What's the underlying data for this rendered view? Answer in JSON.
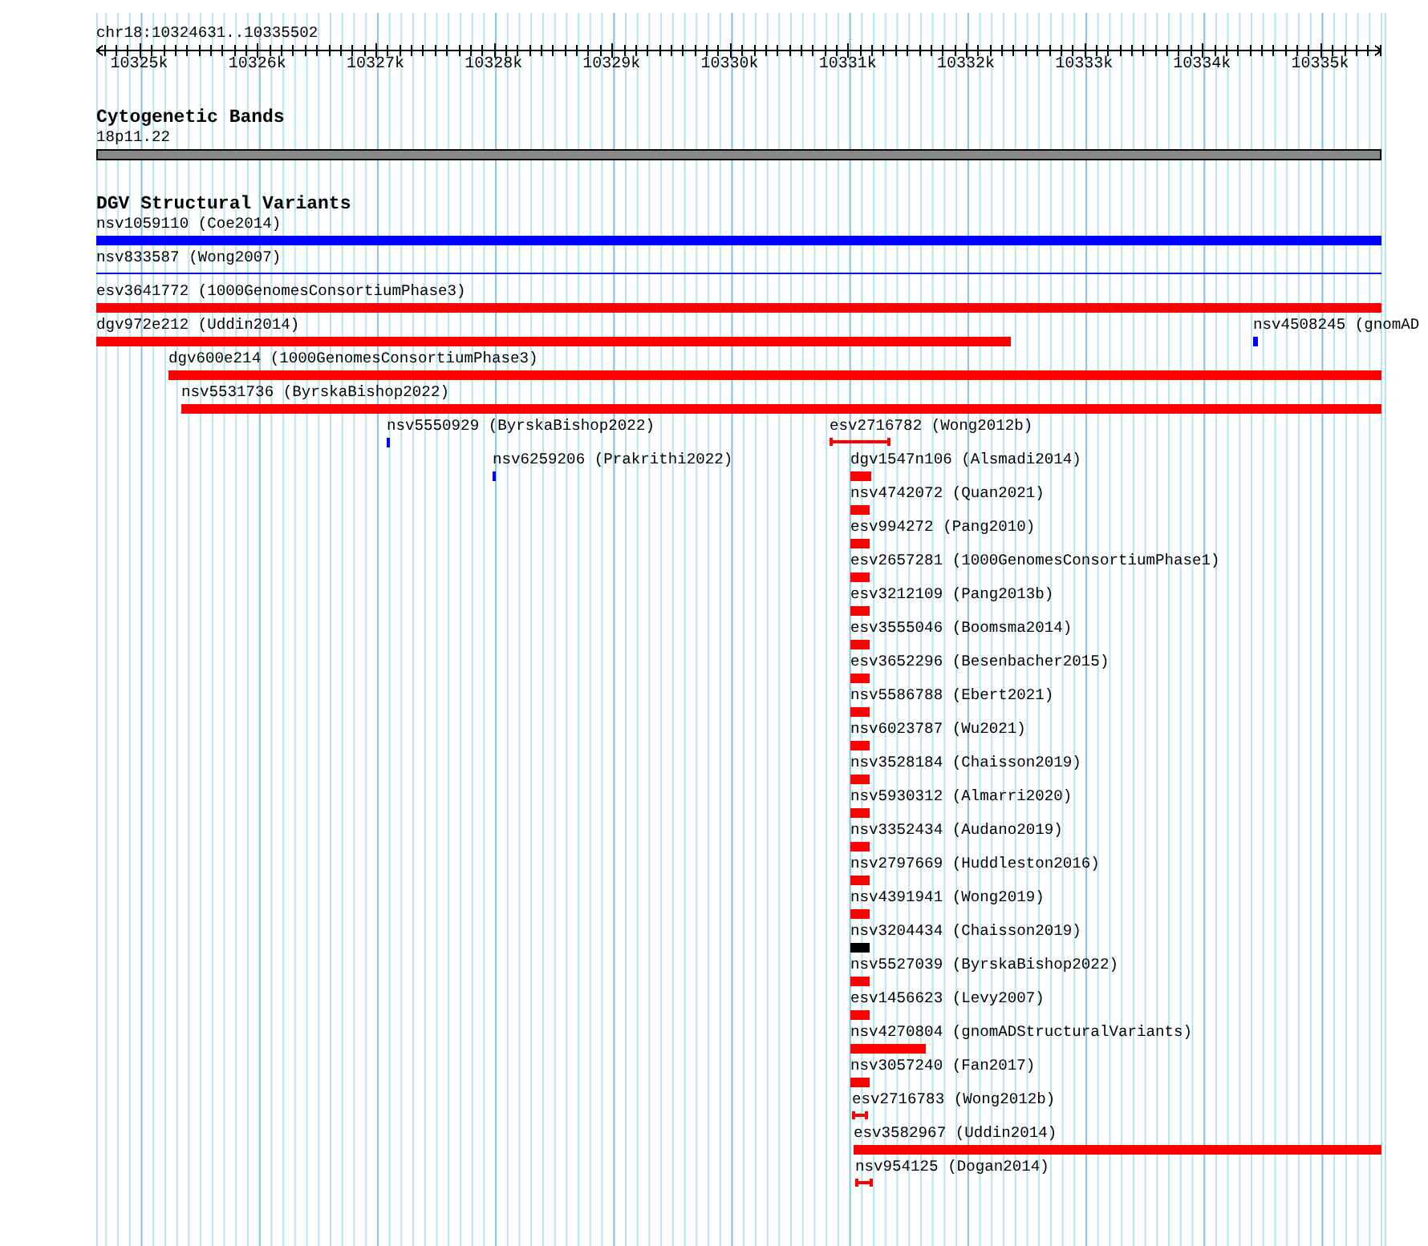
{
  "ruler": {
    "position": "chr18:10324631..10335502",
    "ticks": [
      "10325k",
      "10326k",
      "10327k",
      "10328k",
      "10329k",
      "10330k",
      "10331k",
      "10332k",
      "10333k",
      "10334k",
      "10335k"
    ]
  },
  "cytogenetic_bands": {
    "title": "Cytogenetic Bands",
    "band": "18p11.22"
  },
  "dgv_structural_variants": {
    "title": "DGV Structural Variants",
    "features": [
      {
        "label": "nsv1059110 (Coe2014)",
        "color": "#0000ff",
        "kind": "bar"
      },
      {
        "label": "nsv833587 (Wong2007)",
        "color": "#0000ff",
        "kind": "line"
      },
      {
        "label": "esv3641772 (1000GenomesConsortiumPhase3)",
        "color": "#ff0000",
        "kind": "bar"
      },
      {
        "label": "dgv972e212 (Uddin2014)",
        "color": "#ff0000",
        "kind": "bar"
      },
      {
        "label": "nsv4508245 (gnomAD",
        "color": "#0000ff",
        "kind": "bar"
      },
      {
        "label": "dgv600e214 (1000GenomesConsortiumPhase3)",
        "color": "#ff0000",
        "kind": "bar"
      },
      {
        "label": "nsv5531736 (ByrskaBishop2022)",
        "color": "#ff0000",
        "kind": "bar"
      },
      {
        "label": "nsv5550929 (ByrskaBishop2022)",
        "color": "#0000ff",
        "kind": "bar"
      },
      {
        "label": "esv2716782 (Wong2012b)",
        "color": "#ff0000",
        "kind": "bracket"
      },
      {
        "label": "nsv6259206 (Prakrithi2022)",
        "color": "#0000ff",
        "kind": "bar"
      },
      {
        "label": "dgv1547n106 (Alsmadi2014)",
        "color": "#ff0000",
        "kind": "bar"
      },
      {
        "label": "nsv4742072 (Quan2021)",
        "color": "#ff0000",
        "kind": "bar"
      },
      {
        "label": "esv994272 (Pang2010)",
        "color": "#ff0000",
        "kind": "bar"
      },
      {
        "label": "esv2657281 (1000GenomesConsortiumPhase1)",
        "color": "#ff0000",
        "kind": "bar"
      },
      {
        "label": "esv3212109 (Pang2013b)",
        "color": "#ff0000",
        "kind": "bar"
      },
      {
        "label": "esv3555046 (Boomsma2014)",
        "color": "#ff0000",
        "kind": "bar"
      },
      {
        "label": "esv3652296 (Besenbacher2015)",
        "color": "#ff0000",
        "kind": "bar"
      },
      {
        "label": "nsv5586788 (Ebert2021)",
        "color": "#ff0000",
        "kind": "bar"
      },
      {
        "label": "nsv6023787 (Wu2021)",
        "color": "#ff0000",
        "kind": "bar"
      },
      {
        "label": "nsv3528184 (Chaisson2019)",
        "color": "#ff0000",
        "kind": "bar"
      },
      {
        "label": "nsv5930312 (Almarri2020)",
        "color": "#ff0000",
        "kind": "bar"
      },
      {
        "label": "nsv3352434 (Audano2019)",
        "color": "#ff0000",
        "kind": "bar"
      },
      {
        "label": "nsv2797669 (Huddleston2016)",
        "color": "#ff0000",
        "kind": "bar"
      },
      {
        "label": "nsv4391941 (Wong2019)",
        "color": "#ff0000",
        "kind": "bar"
      },
      {
        "label": "nsv3204434 (Chaisson2019)",
        "color": "#000000",
        "kind": "bar"
      },
      {
        "label": "nsv5527039 (ByrskaBishop2022)",
        "color": "#ff0000",
        "kind": "bar"
      },
      {
        "label": "esv1456623 (Levy2007)",
        "color": "#ff0000",
        "kind": "bar"
      },
      {
        "label": "nsv4270804 (gnomADStructuralVariants)",
        "color": "#ff0000",
        "kind": "bar"
      },
      {
        "label": "nsv3057240 (Fan2017)",
        "color": "#ff0000",
        "kind": "bar"
      },
      {
        "label": "esv2716783 (Wong2012b)",
        "color": "#ff0000",
        "kind": "bracket"
      },
      {
        "label": "esv3582967 (Uddin2014)",
        "color": "#ff0000",
        "kind": "bar"
      },
      {
        "label": "nsv954125 (Dogan2014)",
        "color": "#ff0000",
        "kind": "bracket"
      }
    ]
  }
}
